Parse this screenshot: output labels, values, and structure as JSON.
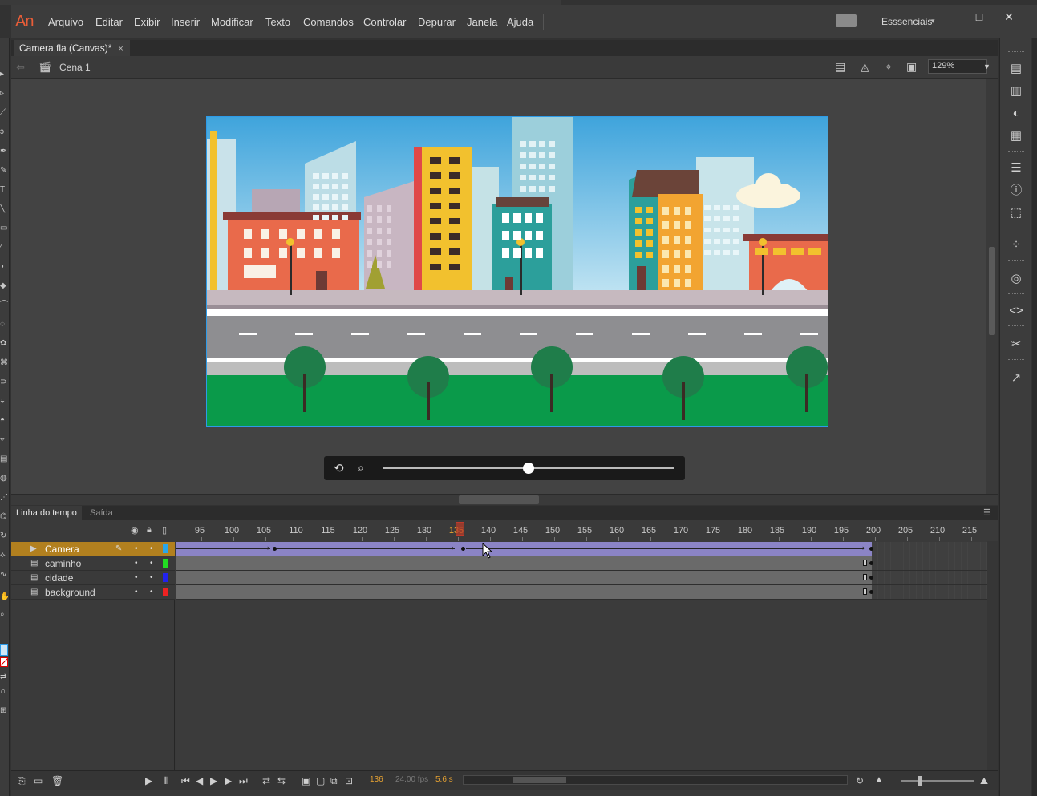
{
  "app": {
    "logo_text": "An",
    "menu": [
      "Arquivo",
      "Editar",
      "Exibir",
      "Inserir",
      "Modificar",
      "Texto",
      "Comandos",
      "Controlar",
      "Depurar",
      "Janela",
      "Ajuda"
    ],
    "workspace_label": "Esssenciais",
    "window_buttons": {
      "minimize": "–",
      "maximize": "□",
      "close": "✕"
    }
  },
  "document": {
    "tab_title": "Camera.fla (Canvas)*",
    "tab_close": "×",
    "scene_label": "Cena 1",
    "zoom": "129%"
  },
  "camera_control": {
    "slider_value": 0.5
  },
  "timeline": {
    "tabs": [
      "Linha do tempo",
      "Saída"
    ],
    "ruler": [
      95,
      100,
      105,
      110,
      115,
      120,
      125,
      130,
      135,
      140,
      145,
      150,
      155,
      160,
      165,
      170,
      175,
      180,
      185,
      190,
      195,
      200,
      205,
      210,
      215
    ],
    "current_frame_marker": 135,
    "layers": [
      {
        "name": "Camera",
        "color": "#2aa6e8",
        "active": true,
        "icon": "camera-icon"
      },
      {
        "name": "caminho",
        "color": "#22dd22",
        "active": false,
        "icon": "layer-icon"
      },
      {
        "name": "cidade",
        "color": "#2222ee",
        "active": false,
        "icon": "layer-icon"
      },
      {
        "name": "background",
        "color": "#ee2222",
        "active": false,
        "icon": "layer-icon"
      }
    ],
    "status": {
      "frame": "136",
      "fps": "24.00 fps",
      "time": "5.6 s"
    }
  },
  "colors": {
    "accent": "#e85d38",
    "active_layer": "#b2801f",
    "tween": "#8b84c6",
    "playhead": "#c0392b",
    "selection": "#2d9be8"
  }
}
